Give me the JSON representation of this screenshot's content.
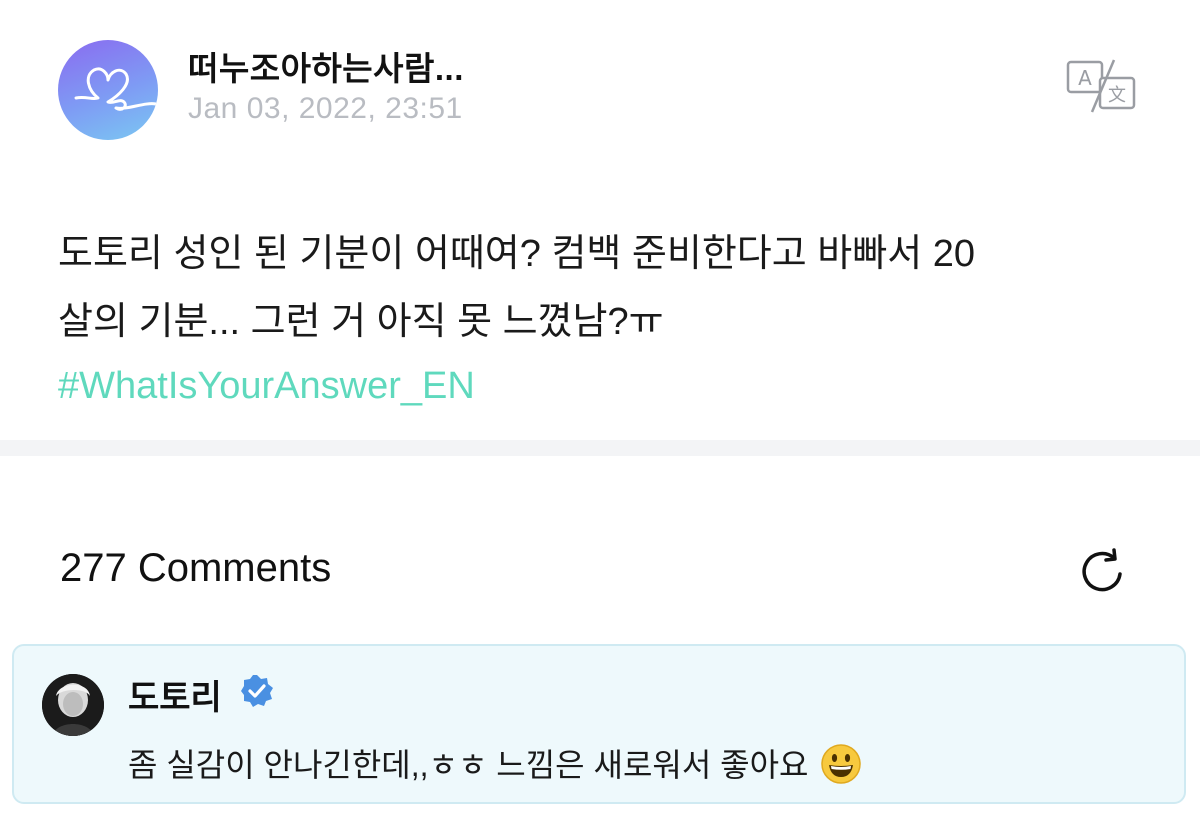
{
  "post": {
    "author_name": "떠누조아하는사람...",
    "timestamp": "Jan 03, 2022, 23:51",
    "body_line_1": "도토리 성인 된 기분이 어때여? 컴백 준비한다고 바빠서 20",
    "body_line_2": "살의 기분... 그런 거 아직 못 느꼈남?ㅠ",
    "hashtag": "#WhatIsYourAnswer_EN",
    "translate_icon": "translate-icon",
    "hashtag_color": "#5fd9bd"
  },
  "comments": {
    "count_label": "277 Comments",
    "refresh_icon": "refresh-icon",
    "items": [
      {
        "author": "도토리",
        "verified": true,
        "text": "좀 실감이 안나긴한데,,ㅎㅎ 느낌은 새로워서 좋아요",
        "emoji": "grinning-face-emoji"
      }
    ]
  },
  "colors": {
    "timestamp": "#b9bcc2",
    "comment_card_bg": "#eef9fc",
    "verified_badge": "#4a90e2"
  }
}
